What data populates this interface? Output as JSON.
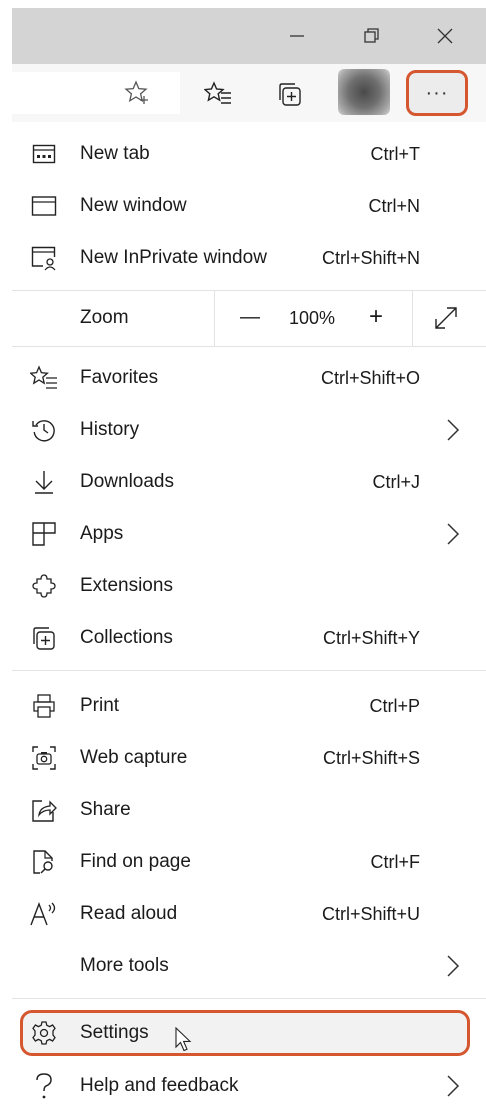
{
  "titlebar": {
    "minimize_icon": "minimize-icon",
    "restore_icon": "restore-icon",
    "close_icon": "close-icon"
  },
  "toolbar": {
    "icons": [
      "add-favorite-icon",
      "favorites-icon",
      "collections-icon",
      "profile-avatar",
      "more-icon"
    ],
    "more_label": "···"
  },
  "menu": {
    "items": [
      {
        "label": "New tab",
        "shortcut": "Ctrl+T",
        "icon": "new-tab-icon"
      },
      {
        "label": "New window",
        "shortcut": "Ctrl+N",
        "icon": "new-window-icon"
      },
      {
        "label": "New InPrivate window",
        "shortcut": "Ctrl+Shift+N",
        "icon": "inprivate-icon"
      }
    ],
    "zoom": {
      "label": "Zoom",
      "minus": "—",
      "value": "100%",
      "plus": "+",
      "fullscreen_icon": "fullscreen-icon"
    },
    "group2": [
      {
        "label": "Favorites",
        "shortcut": "Ctrl+Shift+O",
        "icon": "favorites-icon"
      },
      {
        "label": "History",
        "shortcut": "",
        "icon": "history-icon",
        "submenu": true
      },
      {
        "label": "Downloads",
        "shortcut": "Ctrl+J",
        "icon": "downloads-icon"
      },
      {
        "label": "Apps",
        "shortcut": "",
        "icon": "apps-icon",
        "submenu": true
      },
      {
        "label": "Extensions",
        "shortcut": "",
        "icon": "extensions-icon"
      },
      {
        "label": "Collections",
        "shortcut": "Ctrl+Shift+Y",
        "icon": "collections-icon"
      }
    ],
    "group3": [
      {
        "label": "Print",
        "shortcut": "Ctrl+P",
        "icon": "print-icon"
      },
      {
        "label": "Web capture",
        "shortcut": "Ctrl+Shift+S",
        "icon": "web-capture-icon"
      },
      {
        "label": "Share",
        "shortcut": "",
        "icon": "share-icon"
      },
      {
        "label": "Find on page",
        "shortcut": "Ctrl+F",
        "icon": "find-icon"
      },
      {
        "label": "Read aloud",
        "shortcut": "Ctrl+Shift+U",
        "icon": "read-aloud-icon"
      },
      {
        "label": "More tools",
        "shortcut": "",
        "icon": "",
        "submenu": true
      }
    ],
    "group4": [
      {
        "label": "Settings",
        "shortcut": "",
        "icon": "settings-icon",
        "highlighted": true
      },
      {
        "label": "Help and feedback",
        "shortcut": "",
        "icon": "help-icon",
        "submenu": true
      }
    ]
  },
  "colors": {
    "highlight_border": "#d4572f",
    "titlebar": "#d4d4d4",
    "menu_bg": "#ffffff"
  }
}
